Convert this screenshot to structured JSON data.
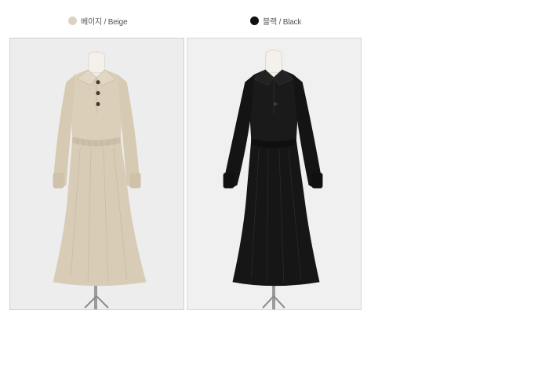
{
  "colors": {
    "beige": {
      "label": "베이지 / Beige",
      "swatch": "#ddd2c0",
      "dress": "#d8ccb6"
    },
    "black": {
      "label": "블랙 / Black",
      "swatch": "#111111",
      "dress": "#161616"
    }
  }
}
